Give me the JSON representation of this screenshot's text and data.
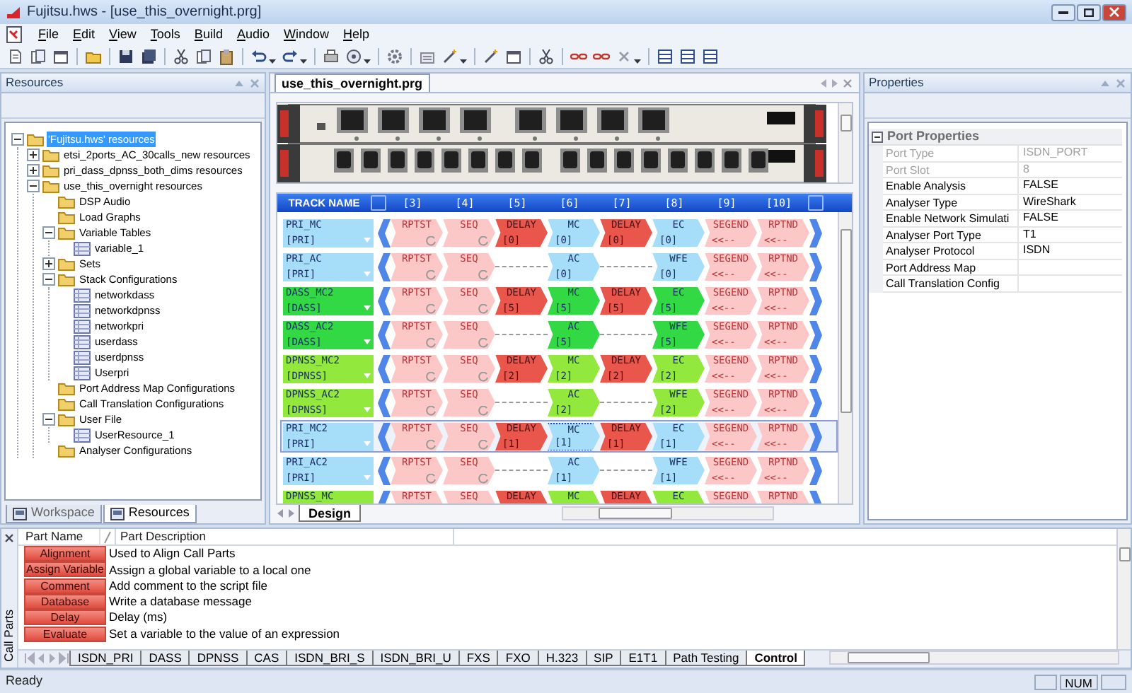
{
  "window": {
    "title": "Fujitsu.hws - [use_this_overnight.prg]"
  },
  "menu": [
    "File",
    "Edit",
    "View",
    "Tools",
    "Build",
    "Audio",
    "Window",
    "Help"
  ],
  "resources_panel": {
    "title": "Resources",
    "tree": [
      {
        "label": "'Fujitsu.hws' resources",
        "kind": "folder",
        "selected": true,
        "expanded": true,
        "children": [
          {
            "label": "etsi_2ports_AC_30calls_new resources",
            "kind": "folder",
            "selected": false,
            "expanded": false
          },
          {
            "label": "pri_dass_dpnss_both_dims resources",
            "kind": "folder",
            "selected": false,
            "expanded": false
          },
          {
            "label": "use_this_overnight resources",
            "kind": "folder",
            "selected": false,
            "expanded": true,
            "children": [
              {
                "label": "DSP Audio",
                "kind": "folder",
                "selected": false
              },
              {
                "label": "Load Graphs",
                "kind": "folder",
                "selected": false
              },
              {
                "label": "Variable Tables",
                "kind": "folder",
                "selected": false,
                "expanded": true,
                "children": [
                  {
                    "label": "variable_1",
                    "kind": "table",
                    "selected": false
                  }
                ]
              },
              {
                "label": "Sets",
                "kind": "folder",
                "selected": false,
                "expanded": false
              },
              {
                "label": "Stack Configurations",
                "kind": "folder",
                "selected": false,
                "expanded": true,
                "children": [
                  {
                    "label": "networkdass",
                    "kind": "table",
                    "selected": false
                  },
                  {
                    "label": "networkdpnss",
                    "kind": "table",
                    "selected": false
                  },
                  {
                    "label": "networkpri",
                    "kind": "table",
                    "selected": false
                  },
                  {
                    "label": "userdass",
                    "kind": "table",
                    "selected": false
                  },
                  {
                    "label": "userdpnss",
                    "kind": "table",
                    "selected": false
                  },
                  {
                    "label": "Userpri",
                    "kind": "table",
                    "selected": false
                  }
                ]
              },
              {
                "label": "Port Address Map Configurations",
                "kind": "folder",
                "selected": false
              },
              {
                "label": "Call Translation Configurations",
                "kind": "folder",
                "selected": false
              },
              {
                "label": "User File",
                "kind": "folder",
                "selected": false,
                "expanded": true,
                "children": [
                  {
                    "label": "UserResource_1",
                    "kind": "table",
                    "selected": false
                  }
                ]
              },
              {
                "label": "Analyser Configurations",
                "kind": "folder",
                "selected": false
              }
            ]
          }
        ]
      }
    ],
    "tabs": [
      {
        "label": "Workspace",
        "selected": false
      },
      {
        "label": "Resources",
        "selected": true
      }
    ]
  },
  "document": {
    "tab": {
      "label": "use_this_overnight.prg",
      "selected": true
    },
    "track_header": {
      "name": "TRACK NAME",
      "columns": [
        "[3]",
        "[4]",
        "[5]",
        "[6]",
        "[7]",
        "[8]",
        "[9]",
        "[10]"
      ]
    },
    "tracks": [
      {
        "name": "PRI_MC",
        "protocol": "[PRI]",
        "color": "#a6defa",
        "selected": false,
        "cells": [
          {
            "kind": "part",
            "label": "RPTST",
            "selected": false
          },
          {
            "kind": "part",
            "label": "SEQ",
            "selected": false
          },
          {
            "kind": "delay",
            "label": "DELAY",
            "value": "[0]",
            "selected": false
          },
          {
            "kind": "call",
            "label": "MC",
            "value": "[0]",
            "selected": false
          },
          {
            "kind": "delay",
            "label": "DELAY",
            "value": "[0]",
            "selected": false
          },
          {
            "kind": "call",
            "label": "EC",
            "value": "[0]",
            "selected": false
          },
          {
            "kind": "marker",
            "label": "SEGEND",
            "value": "<<--",
            "selected": false
          },
          {
            "kind": "marker",
            "label": "RPTND",
            "value": "<<--",
            "selected": false
          }
        ]
      },
      {
        "name": "PRI_AC",
        "protocol": "[PRI]",
        "color": "#a6defa",
        "selected": false,
        "cells": [
          {
            "kind": "part",
            "label": "RPTST",
            "selected": false
          },
          {
            "kind": "part",
            "label": "SEQ",
            "selected": false
          },
          {
            "kind": "empty",
            "selected": false
          },
          {
            "kind": "call",
            "label": "AC",
            "value": "[0]",
            "selected": false
          },
          {
            "kind": "empty",
            "selected": false
          },
          {
            "kind": "call",
            "label": "WFE",
            "value": "[0]",
            "selected": false
          },
          {
            "kind": "marker",
            "label": "SEGEND",
            "value": "<<--",
            "selected": false
          },
          {
            "kind": "marker",
            "label": "RPTND",
            "value": "<<--",
            "selected": false
          }
        ]
      },
      {
        "name": "DASS_MC2",
        "protocol": "[DASS]",
        "color": "#33d944",
        "selected": false,
        "cells": [
          {
            "kind": "part",
            "label": "RPTST",
            "selected": false
          },
          {
            "kind": "part",
            "label": "SEQ",
            "selected": false
          },
          {
            "kind": "delay",
            "label": "DELAY",
            "value": "[5]",
            "selected": false
          },
          {
            "kind": "call",
            "label": "MC",
            "value": "[5]",
            "selected": false
          },
          {
            "kind": "delay",
            "label": "DELAY",
            "value": "[5]",
            "selected": false
          },
          {
            "kind": "call",
            "label": "EC",
            "value": "[5]",
            "selected": false
          },
          {
            "kind": "marker",
            "label": "SEGEND",
            "value": "<<--",
            "selected": false
          },
          {
            "kind": "marker",
            "label": "RPTND",
            "value": "<<--",
            "selected": false
          }
        ]
      },
      {
        "name": "DASS_AC2",
        "protocol": "[DASS]",
        "color": "#33d944",
        "selected": false,
        "cells": [
          {
            "kind": "part",
            "label": "RPTST",
            "selected": false
          },
          {
            "kind": "part",
            "label": "SEQ",
            "selected": false
          },
          {
            "kind": "empty",
            "selected": false
          },
          {
            "kind": "call",
            "label": "AC",
            "value": "[5]",
            "selected": false
          },
          {
            "kind": "empty",
            "selected": false
          },
          {
            "kind": "call",
            "label": "WFE",
            "value": "[5]",
            "selected": false
          },
          {
            "kind": "marker",
            "label": "SEGEND",
            "value": "<<--",
            "selected": false
          },
          {
            "kind": "marker",
            "label": "RPTND",
            "value": "<<--",
            "selected": false
          }
        ]
      },
      {
        "name": "DPNSS_MC2",
        "protocol": "[DPNSS]",
        "color": "#92e83c",
        "selected": false,
        "cells": [
          {
            "kind": "part",
            "label": "RPTST",
            "selected": false
          },
          {
            "kind": "part",
            "label": "SEQ",
            "selected": false
          },
          {
            "kind": "delay",
            "label": "DELAY",
            "value": "[2]",
            "selected": false
          },
          {
            "kind": "call",
            "label": "MC",
            "value": "[2]",
            "selected": false
          },
          {
            "kind": "delay",
            "label": "DELAY",
            "value": "[2]",
            "selected": false
          },
          {
            "kind": "call",
            "label": "EC",
            "value": "[2]",
            "selected": false
          },
          {
            "kind": "marker",
            "label": "SEGEND",
            "value": "<<--",
            "selected": false
          },
          {
            "kind": "marker",
            "label": "RPTND",
            "value": "<<--",
            "selected": false
          }
        ]
      },
      {
        "name": "DPNSS_AC2",
        "protocol": "[DPNSS]",
        "color": "#92e83c",
        "selected": false,
        "cells": [
          {
            "kind": "part",
            "label": "RPTST",
            "selected": false
          },
          {
            "kind": "part",
            "label": "SEQ",
            "selected": false
          },
          {
            "kind": "empty",
            "selected": false
          },
          {
            "kind": "call",
            "label": "AC",
            "value": "[2]",
            "selected": false
          },
          {
            "kind": "empty",
            "selected": false
          },
          {
            "kind": "call",
            "label": "WFE",
            "value": "[2]",
            "selected": false
          },
          {
            "kind": "marker",
            "label": "SEGEND",
            "value": "<<--",
            "selected": false
          },
          {
            "kind": "marker",
            "label": "RPTND",
            "value": "<<--",
            "selected": false
          }
        ]
      },
      {
        "name": "PRI_MC2",
        "protocol": "[PRI]",
        "color": "#a6defa",
        "selected": true,
        "cells": [
          {
            "kind": "part",
            "label": "RPTST",
            "selected": false
          },
          {
            "kind": "part",
            "label": "SEQ",
            "selected": false
          },
          {
            "kind": "delay",
            "label": "DELAY",
            "value": "[1]",
            "selected": false
          },
          {
            "kind": "call",
            "label": "MC",
            "value": "[1]",
            "selected": true
          },
          {
            "kind": "delay",
            "label": "DELAY",
            "value": "[1]",
            "selected": false
          },
          {
            "kind": "call",
            "label": "EC",
            "value": "[1]",
            "selected": false
          },
          {
            "kind": "marker",
            "label": "SEGEND",
            "value": "<<--",
            "selected": false
          },
          {
            "kind": "marker",
            "label": "RPTND",
            "value": "<<--",
            "selected": false
          }
        ]
      },
      {
        "name": "PRI_AC2",
        "protocol": "[PRI]",
        "color": "#a6defa",
        "selected": false,
        "cells": [
          {
            "kind": "part",
            "label": "RPTST",
            "selected": false
          },
          {
            "kind": "part",
            "label": "SEQ",
            "selected": false
          },
          {
            "kind": "empty",
            "selected": false
          },
          {
            "kind": "call",
            "label": "AC",
            "value": "[1]",
            "selected": false
          },
          {
            "kind": "empty",
            "selected": false
          },
          {
            "kind": "call",
            "label": "WFE",
            "value": "[1]",
            "selected": false
          },
          {
            "kind": "marker",
            "label": "SEGEND",
            "value": "<<--",
            "selected": false
          },
          {
            "kind": "marker",
            "label": "RPTND",
            "value": "<<--",
            "selected": false
          }
        ]
      },
      {
        "name": "DPNSS_MC",
        "color": "#92e83c",
        "selected": false,
        "cells": [
          {
            "kind": "part",
            "label": "RPTST",
            "selected": false
          },
          {
            "kind": "part",
            "label": "SEQ",
            "selected": false
          },
          {
            "kind": "delay",
            "label": "DELAY",
            "selected": false
          },
          {
            "kind": "call",
            "label": "MC",
            "selected": false
          },
          {
            "kind": "delay",
            "label": "DELAY",
            "selected": false
          },
          {
            "kind": "call",
            "label": "EC",
            "selected": false
          },
          {
            "kind": "marker",
            "label": "SEGEND",
            "selected": false
          },
          {
            "kind": "marker",
            "label": "RPTND",
            "selected": false
          }
        ]
      }
    ],
    "bottom_tabs": [
      {
        "label": "Design",
        "selected": true
      }
    ]
  },
  "properties_panel": {
    "title": "Properties",
    "group": {
      "label": "Port Properties",
      "expanded": true,
      "rows": [
        {
          "name": "Port Type",
          "value": "ISDN_PORT",
          "disabled": true
        },
        {
          "name": "Port Slot",
          "value": "8",
          "disabled": true
        },
        {
          "name": "Enable Analysis",
          "value": "FALSE",
          "disabled": false
        },
        {
          "name": "Analyser Type",
          "value": "WireShark",
          "disabled": false
        },
        {
          "name": "Enable Network Simulati",
          "value": "FALSE",
          "disabled": false
        },
        {
          "name": "Analyser Port Type",
          "value": "T1",
          "disabled": false
        },
        {
          "name": "Analyser Protocol",
          "value": "ISDN",
          "disabled": false
        },
        {
          "name": "Port Address Map",
          "disabled": false
        },
        {
          "name": "Call Translation Config",
          "disabled": false
        }
      ]
    }
  },
  "call_parts_panel": {
    "title": "Call Parts",
    "columns": [
      "Part Name",
      "Part Description"
    ],
    "rows": [
      {
        "name": "Alignment",
        "description": "Used to Align Call Parts"
      },
      {
        "name": "Assign Variable",
        "description": "Assign a global variable to a local one"
      },
      {
        "name": "Comment",
        "description": "Add comment to the script file"
      },
      {
        "name": "Database",
        "description": "Write a database message"
      },
      {
        "name": "Delay",
        "description": "Delay (ms)"
      },
      {
        "name": "Evaluate",
        "description": "Set a variable to the value of an expression"
      }
    ],
    "tabs": [
      {
        "label": "ISDN_PRI",
        "selected": false
      },
      {
        "label": "DASS",
        "selected": false
      },
      {
        "label": "DPNSS",
        "selected": false
      },
      {
        "label": "CAS",
        "selected": false
      },
      {
        "label": "ISDN_BRI_S",
        "selected": false
      },
      {
        "label": "ISDN_BRI_U",
        "selected": false
      },
      {
        "label": "FXS",
        "selected": false
      },
      {
        "label": "FXO",
        "selected": false
      },
      {
        "label": "H.323",
        "selected": false
      },
      {
        "label": "SIP",
        "selected": false
      },
      {
        "label": "E1T1",
        "selected": false
      },
      {
        "label": "Path Testing",
        "selected": false
      },
      {
        "label": "Control",
        "selected": true
      }
    ]
  },
  "status_bar": {
    "text": "Ready",
    "indicator": "NUM"
  }
}
